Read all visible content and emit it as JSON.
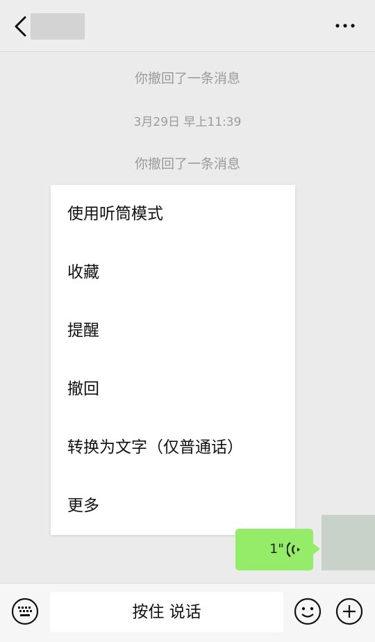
{
  "header": {
    "back_icon": "chevron-left-icon",
    "more_icon": "more-horizontal-icon"
  },
  "messages": {
    "recall_1": "你撤回了一条消息",
    "timestamp": "3月29日 早上11:39",
    "recall_2": "你撤回了一条消息"
  },
  "context_menu": {
    "items": [
      "使用听筒模式",
      "收藏",
      "提醒",
      "撤回",
      "转换为文字（仅普通话）",
      "更多"
    ]
  },
  "voice_message": {
    "duration": "1\"",
    "icon": "voice-wave-icon",
    "bubble_color": "#95ec69"
  },
  "input_bar": {
    "hold_to_talk": "按住 说话",
    "keyboard_icon": "keyboard-icon",
    "emoji_icon": "emoji-icon",
    "plus_icon": "plus-icon"
  }
}
